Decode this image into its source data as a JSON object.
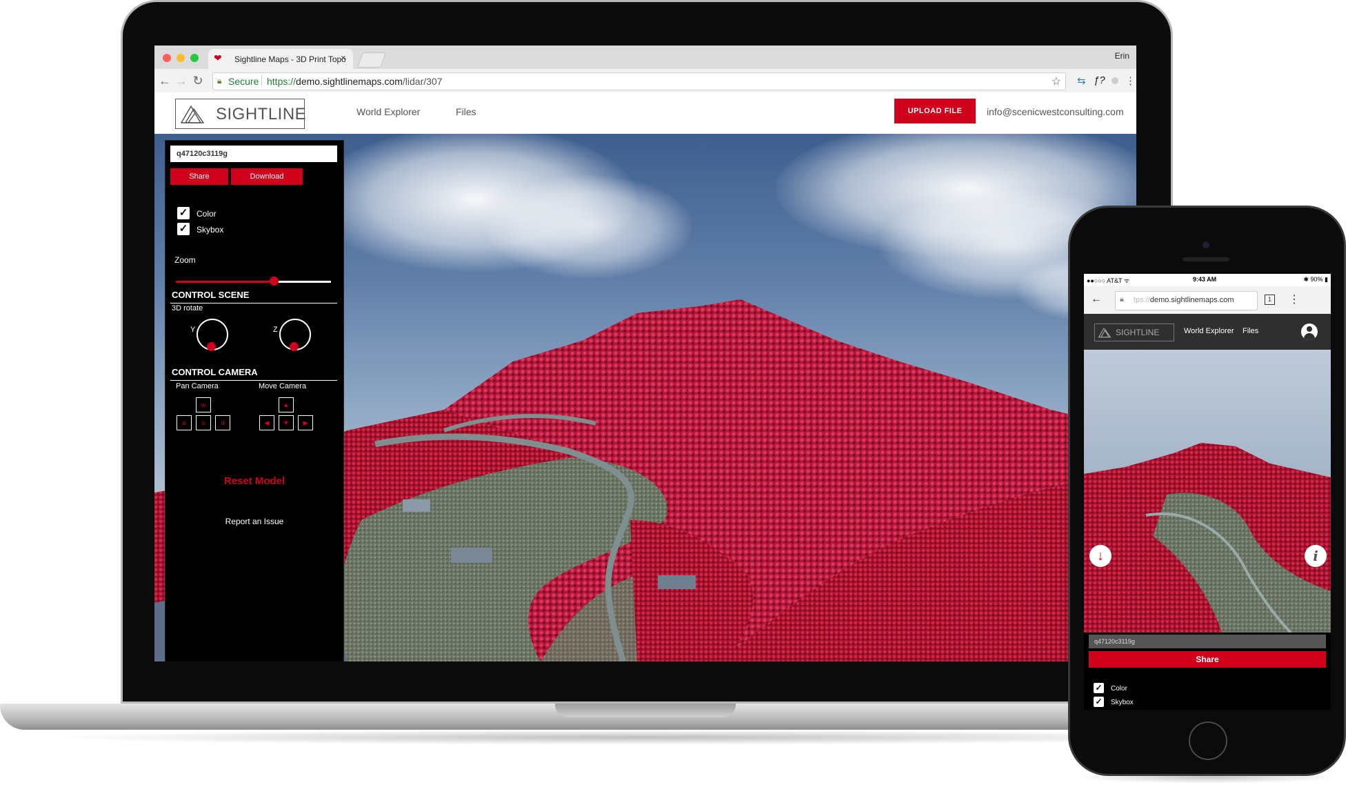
{
  "browser": {
    "tab_title": "Sightline Maps - 3D Print Topo",
    "tab_close": "×",
    "user": "Erin",
    "secure_label": "Secure",
    "url_scheme": "https://",
    "url_host": "demo.sightlinemaps.com",
    "url_path": "/lidar/307",
    "back": "←",
    "forward": "→",
    "reload": "↻",
    "star": "☆",
    "ext_1": "⇆",
    "ext_2": "ƒ?",
    "ext_3": "⋮"
  },
  "site": {
    "logo_text": "SIGHTLINE",
    "nav": [
      "World Explorer",
      "Files"
    ],
    "upload_label": "UPLOAD FILE",
    "email": "info@scenicwestconsulting.com"
  },
  "sidebar": {
    "model_id": "q47120c3119g",
    "share_label": "Share",
    "download_label": "Download",
    "checkboxes": [
      {
        "label": "Color",
        "checked": true
      },
      {
        "label": "Skybox",
        "checked": true
      }
    ],
    "check_glyph": "✓",
    "zoom_label": "Zoom",
    "zoom_level": 0.63,
    "control_scene": "CONTROL SCENE",
    "rotate_label": "3D rotate",
    "axis_y": "Y",
    "axis_z": "Z",
    "control_camera": "CONTROL CAMERA",
    "pan_camera": "Pan Camera",
    "move_camera": "Move Camera",
    "pan_keys": [
      "w",
      "a",
      "s",
      "d"
    ],
    "move_keys": [
      "▲",
      "◀",
      "▼",
      "▶"
    ],
    "reset_label": "Reset Model",
    "report_label": "Report an Issue"
  },
  "phone": {
    "carrier": "●●○○○ AT&T ᯤ",
    "time": "9:43 AM",
    "battery": "✱ 90% ▮",
    "url_faded": "tps://",
    "url_host": "demo.sightlinemaps.com",
    "tabs_count": "1",
    "menu": "⋮",
    "back": "←",
    "logo_text": "SIGHTLINE",
    "nav": [
      "World Explorer",
      "Files"
    ],
    "download_glyph": "↓",
    "info_glyph": "i",
    "model_id": "q47120c3119g",
    "share_label": "Share",
    "checkboxes": [
      {
        "label": "Color",
        "checked": true
      },
      {
        "label": "Skybox",
        "checked": true
      }
    ]
  },
  "colors": {
    "accent": "#d0021b",
    "sidebar_bg": "#000000",
    "foliage": "#b3122f",
    "terrain": "#6b7563"
  }
}
